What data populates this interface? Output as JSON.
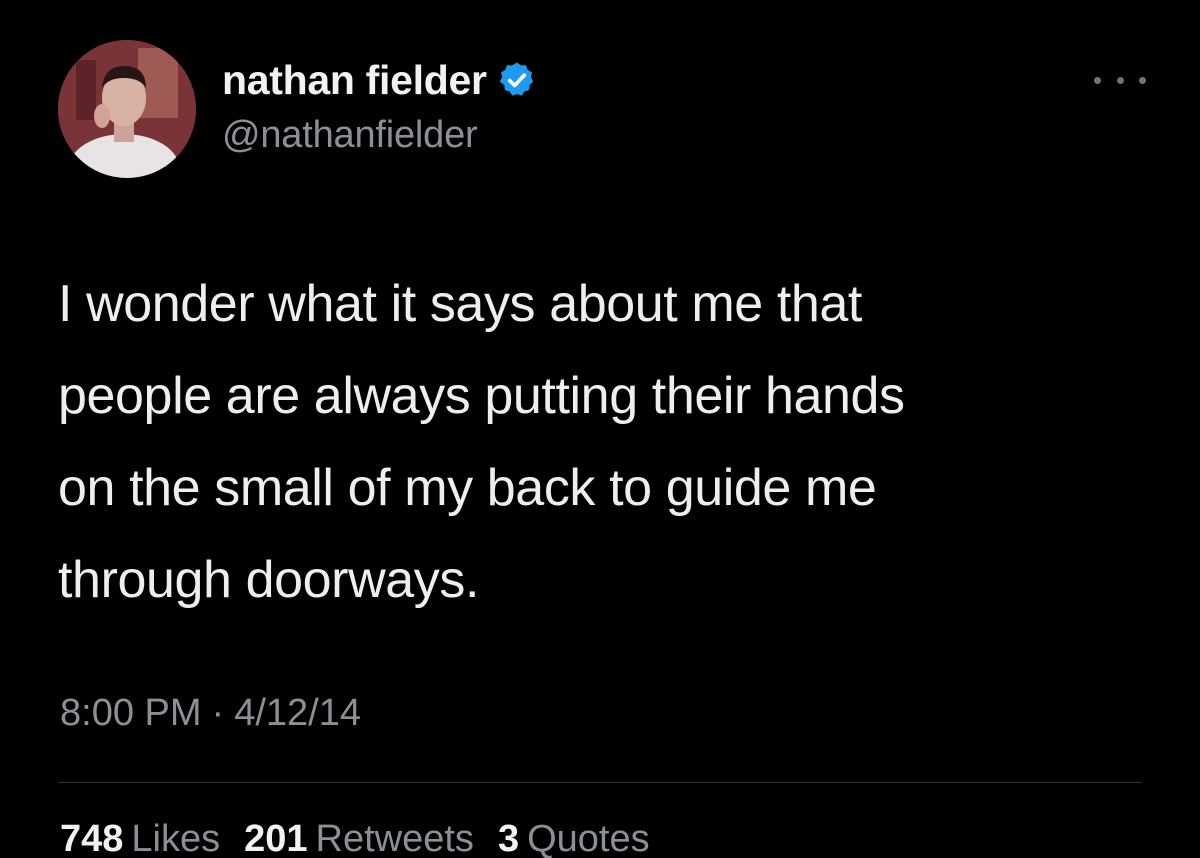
{
  "author": {
    "display_name": "nathan fielder",
    "handle": "@nathanfielder",
    "verified": true,
    "avatar_icon": "profile-photo"
  },
  "tweet": {
    "text_lines": [
      "I wonder what it says about me that",
      "people are always putting their hands",
      "on the small of my back to guide me",
      "through doorways."
    ],
    "time": "8:00 PM",
    "separator": "·",
    "date": "4/12/14"
  },
  "stats": {
    "likes_count": "748",
    "likes_label": "Likes",
    "retweets_count": "201",
    "retweets_label": "Retweets",
    "quotes_count": "3",
    "quotes_label": "Quotes"
  },
  "colors": {
    "background": "#000000",
    "primary_text": "#eeeeee",
    "secondary_text": "#8b9096",
    "verified_badge": "#1d9bf0",
    "divider": "#2f3336"
  }
}
